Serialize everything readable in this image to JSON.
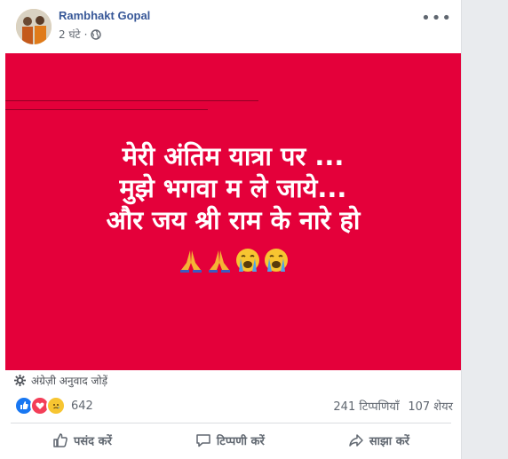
{
  "post": {
    "author": "Rambhakt Gopal",
    "time": "2 घंटे",
    "privacy_icon": "globe-icon",
    "more_label": "•••",
    "image_text": {
      "line1": "मेरी अंतिम यात्रा पर ...",
      "line2": "मुझे भगवा म ले जाये...",
      "line3": "और जय श्री राम के नारे हो"
    },
    "image_emojis": [
      "folded-hands",
      "folded-hands",
      "loudly-crying-face",
      "loudly-crying-face"
    ],
    "image_bg_color": "#e4003a"
  },
  "translate": {
    "icon": "gear-icon",
    "label": "अंग्रेज़ी अनुवाद जोड़ें"
  },
  "engagement": {
    "reactions": [
      "like",
      "love",
      "sad"
    ],
    "reaction_count": "642",
    "comments": "241 टिप्पणियाँ",
    "shares": "107 शेयर"
  },
  "actions": {
    "like": "पसंद करें",
    "comment": "टिप्पणी करें",
    "share": "साझा करें"
  }
}
